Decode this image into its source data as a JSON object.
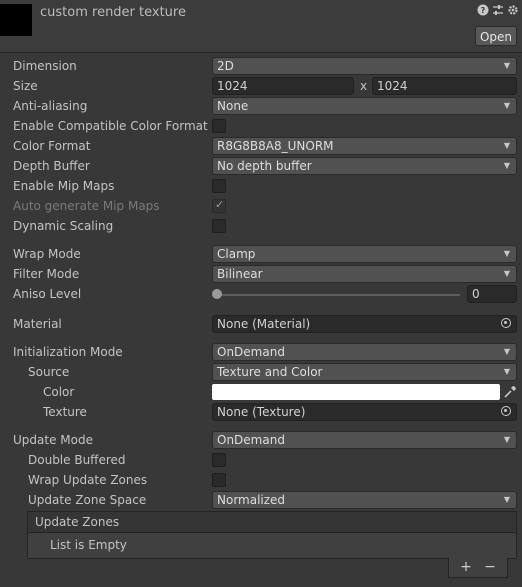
{
  "header": {
    "title": "custom render texture",
    "open_label": "Open",
    "icons": [
      "help-icon",
      "preset-icon",
      "settings-icon"
    ]
  },
  "fields": {
    "dimension": {
      "label": "Dimension",
      "value": "2D"
    },
    "size": {
      "label": "Size",
      "width": "1024",
      "sep": "x",
      "height": "1024"
    },
    "anti_aliasing": {
      "label": "Anti-aliasing",
      "value": "None"
    },
    "enable_compatible_color_format": {
      "label": "Enable Compatible Color Format",
      "checked": false
    },
    "color_format": {
      "label": "Color Format",
      "value": "R8G8B8A8_UNORM"
    },
    "depth_buffer": {
      "label": "Depth Buffer",
      "value": "No depth buffer"
    },
    "enable_mip_maps": {
      "label": "Enable Mip Maps",
      "checked": false
    },
    "auto_generate_mip_maps": {
      "label": "Auto generate Mip Maps",
      "checked": true,
      "disabled": true
    },
    "dynamic_scaling": {
      "label": "Dynamic Scaling",
      "checked": false
    },
    "wrap_mode": {
      "label": "Wrap Mode",
      "value": "Clamp"
    },
    "filter_mode": {
      "label": "Filter Mode",
      "value": "Bilinear"
    },
    "aniso_level": {
      "label": "Aniso Level",
      "value": "0"
    },
    "material": {
      "label": "Material",
      "value": "None (Material)"
    },
    "initialization_mode": {
      "label": "Initialization Mode",
      "value": "OnDemand"
    },
    "source": {
      "label": "Source",
      "value": "Texture and Color"
    },
    "color": {
      "label": "Color",
      "value": "#ffffff"
    },
    "texture": {
      "label": "Texture",
      "value": "None (Texture)"
    },
    "update_mode": {
      "label": "Update Mode",
      "value": "OnDemand"
    },
    "double_buffered": {
      "label": "Double Buffered",
      "checked": false
    },
    "wrap_update_zones": {
      "label": "Wrap Update Zones",
      "checked": false
    },
    "update_zone_space": {
      "label": "Update Zone Space",
      "value": "Normalized"
    }
  },
  "update_zones": {
    "title": "Update Zones",
    "empty_text": "List is Empty",
    "add_label": "+",
    "remove_label": "−"
  },
  "colors": {
    "background": "#383838",
    "field": "#2a2a2a",
    "dropdown": "#515151"
  }
}
